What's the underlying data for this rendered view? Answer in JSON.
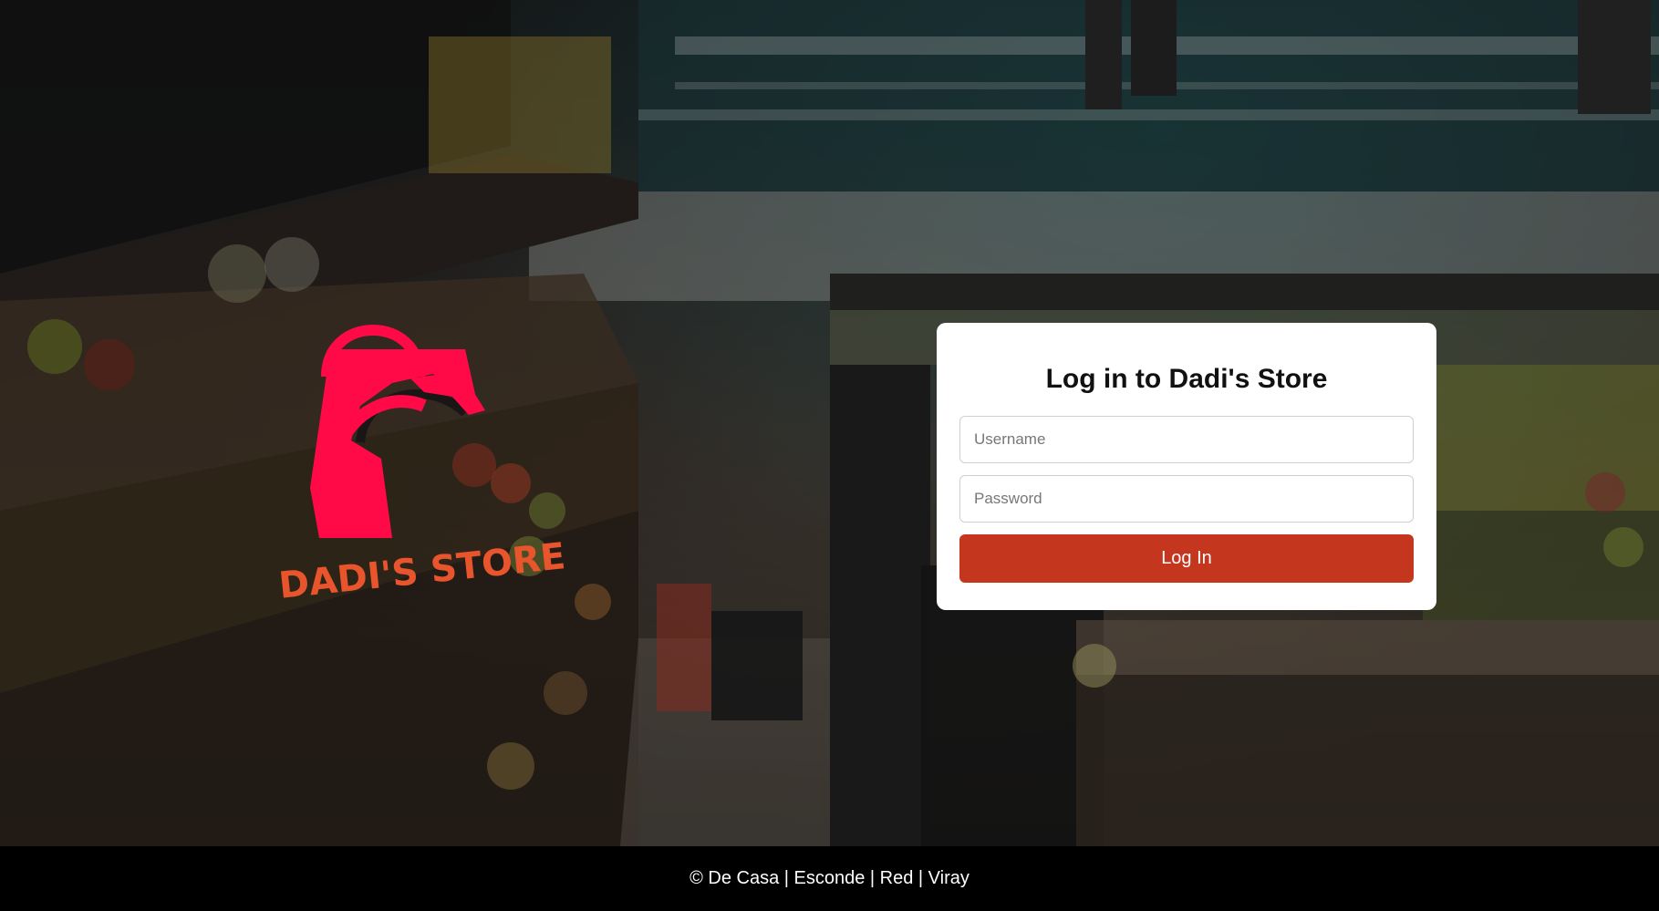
{
  "brand": {
    "logo_text": "DADI'S STORE",
    "logo_icon": "shopping-bag-icon",
    "logo_color": "#ff0a47",
    "logo_text_color": "#e8542b"
  },
  "login": {
    "title": "Log in to Dadi's Store",
    "username_placeholder": "Username",
    "password_placeholder": "Password",
    "button_label": "Log In",
    "button_color": "#c5361e"
  },
  "footer": {
    "text": "© De Casa | Esconde | Red | Viray"
  }
}
